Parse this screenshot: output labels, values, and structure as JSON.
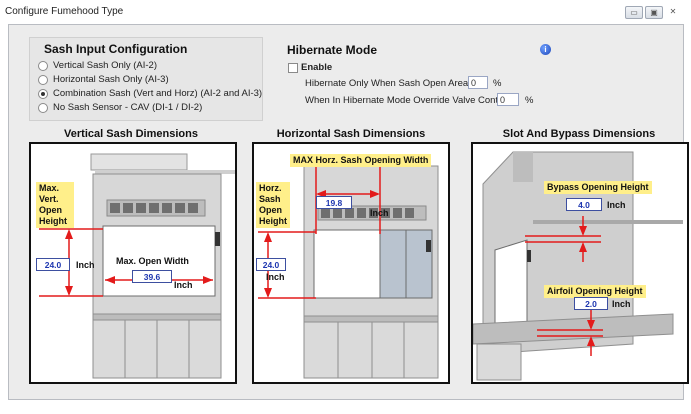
{
  "window": {
    "title": "Configure Fumehood Type",
    "buttons": [
      "▭",
      "▣",
      "✕"
    ]
  },
  "sash_input": {
    "heading": "Sash Input Configuration",
    "options": [
      {
        "label": "Vertical Sash Only (AI-2)",
        "selected": false
      },
      {
        "label": "Horizontal Sash Only (AI-3)",
        "selected": false
      },
      {
        "label": "Combination Sash (Vert and Horz) (AI-2 and AI-3)",
        "selected": true
      },
      {
        "label": "No Sash Sensor - CAV (DI-1 / DI-2)",
        "selected": false
      }
    ]
  },
  "hibernate": {
    "heading": "Hibernate Mode",
    "enable_label": "Enable",
    "enabled": false,
    "open_area_label": "Hibernate Only When Sash Open Area <",
    "open_area_value": "0",
    "open_area_unit": "%",
    "override_label": "When In Hibernate Mode Override Valve Control:",
    "override_value": "0",
    "override_unit": "%",
    "info_icon": "i"
  },
  "vertical_dims": {
    "heading": "Vertical Sash Dimensions",
    "max_open_height_label": "Max.\nVert.\nOpen\nHeight",
    "height_value": "24.0",
    "height_unit": "Inch",
    "max_open_width_label": "Max. Open Width",
    "width_value": "39.6",
    "width_unit": "Inch"
  },
  "horizontal_dims": {
    "heading": "Horizontal Sash Dimensions",
    "max_horz_label": "MAX Horz. Sash Opening Width",
    "width_value": "19.8",
    "width_unit": "Inch",
    "open_height_label": "Horz.\nSash\nOpen\nHeight",
    "height_value": "24.0",
    "height_unit": "Inch"
  },
  "slot_dims": {
    "heading": "Slot And Bypass Dimensions",
    "bypass_label": "Bypass Opening Height",
    "bypass_value": "4.0",
    "bypass_unit": "Inch",
    "airfoil_label": "Airfoil Opening Height",
    "airfoil_value": "2.0",
    "airfoil_unit": "Inch"
  },
  "colors": {
    "label_bg": "#ffef8a",
    "arrow": "#e31b1b",
    "value_text": "#1d36b0"
  }
}
